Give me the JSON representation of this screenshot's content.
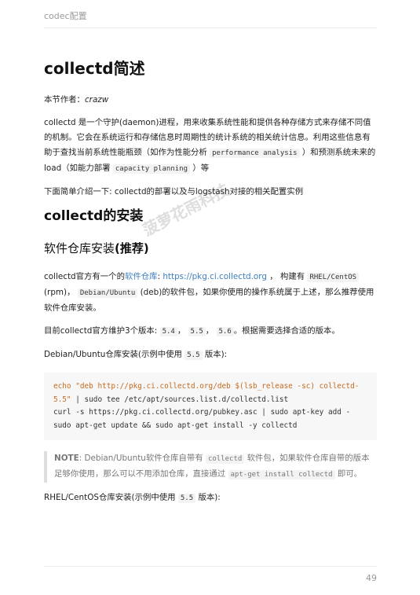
{
  "header": {
    "title": "codec配置"
  },
  "section": {
    "title": "collectd简述",
    "author_label": "本节作者：",
    "author": "crazw",
    "intro_a": "collectd 是一个守护(daemon)进程，用来收集系统性能和提供各种存储方式来存储不同值的机制。它会在系统运行和存储信息时周期性的统计系统的相关统计信息。利用这些信息有助于查找当前系统性能瓶颈（如作为性能分析",
    "intro_code1": "performance analysis",
    "intro_b": "）和预测系统未来的 load（如能力部署",
    "intro_code2": "capacity planning",
    "intro_c": "）等",
    "summary": "下面简单介绍一下: collectd的部署以及与logstash对接的相关配置实例"
  },
  "install": {
    "title": "collectd的安装",
    "subtitle_a": "软件仓库安装",
    "subtitle_b": "(推荐)",
    "p1_a": "collectd官方有一个的",
    "p1_link": "软件仓库",
    "p1_colon": ": ",
    "p1_url": "https://pkg.ci.collectd.org",
    "p1_b": "， 构建有",
    "p1_code1": "RHEL/CentOS",
    "p1_c": "(rpm)，",
    "p1_code2": "Debian/Ubuntu",
    "p1_d": "(deb)的软件包，如果你使用的操作系统属于上述，那么推荐使用软件仓库安装。",
    "p2_a": "目前collectd官方维护3个版本:",
    "p2_v1": "5.4",
    "p2_sep1": "，",
    "p2_v2": "5.5",
    "p2_sep2": "，",
    "p2_v3": "5.6",
    "p2_b": "。根据需要选择合适的版本。",
    "p3_a": "Debian/Ubuntu仓库安装(示例中使用",
    "p3_code": "5.5",
    "p3_b": "版本):",
    "code_echo": "echo",
    "code_str": " \"deb http://pkg.ci.collectd.org/deb $(lsb_release -sc) collectd-5.5\"",
    "code_rest": " | sudo tee /etc/apt/sources.list.d/collectd.list\ncurl -s https://pkg.ci.collectd.org/pubkey.asc | sudo apt-key add -\nsudo apt-get update && sudo apt-get install -y collectd",
    "note_label": "NOTE",
    "note_a": ": Debian/Ubuntu软件仓库自带有",
    "note_code1": "collectd",
    "note_b": "软件包，如果软件仓库自带的版本足够你使用，那么可以不用添加仓库，直接通过",
    "note_code2": "apt-get install collectd",
    "note_c": "即可。",
    "p4_a": "RHEL/CentOS仓库安装(示例中使用",
    "p4_code": "5.5",
    "p4_b": "版本):"
  },
  "watermark": "菠萝花雨科技",
  "footer": {
    "page_number": "49"
  }
}
